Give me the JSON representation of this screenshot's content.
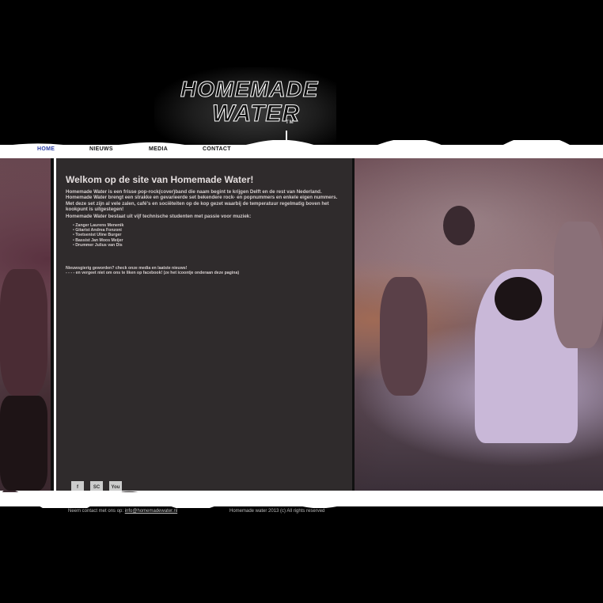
{
  "logo": {
    "line1": "HOMEMADE",
    "line2": "WATER",
    "mark": "TM"
  },
  "nav": {
    "items": [
      {
        "label": "HOME"
      },
      {
        "label": "NIEUWS"
      },
      {
        "label": "MEDIA"
      },
      {
        "label": "CONTACT"
      }
    ],
    "active_color": "#2b3fa8"
  },
  "content": {
    "title": "Welkom op de site van Homemade Water!",
    "intro": "Homemade Water is een frisse pop-rock(cover)band die naam begint te krijgen Delft en de rest van Nederland. Homemade Water brengt een strakke en gevarieerde set bekendere rock- en popnummers en enkele eigen nummers. Met deze set zijn al vele zalen, café's en sociëteiten op de kop gezet waarbij de temperatuur regelmatig boven het kookpunt is uitgestegen!",
    "members_intro": "Homemade Water bestaat uit vijf technische studenten met passie voor muziek:",
    "members": [
      "Zanger Laurens Menenik",
      "Gitarist Andrea Fonzoni",
      "Toetsenist Uline Burger",
      "Bassist Jan Moos Meijer",
      "Drummer Julius van Dis"
    ],
    "curious": "Nieuwsgierig geworden? check onze media en laatste nieuws!",
    "facebook_note": "- - - - en vergeet niet om ons te liken op facebook! (ze het icoontje onderaan deze pagina)"
  },
  "social": [
    {
      "icon": "facebook-icon",
      "glyph": "f"
    },
    {
      "icon": "soundcloud-icon",
      "glyph": "SC"
    },
    {
      "icon": "youtube-icon",
      "glyph": "You"
    }
  ],
  "footer": {
    "contact_prefix": "Neem contact met ons op:",
    "email": "info@homemadewater.nl",
    "copyright": "Homemade water 2013 (c) All rights reserved"
  },
  "colors": {
    "page_bg": "#000000",
    "panel_bg": "#2f2b2c",
    "band": "#ffffff"
  }
}
